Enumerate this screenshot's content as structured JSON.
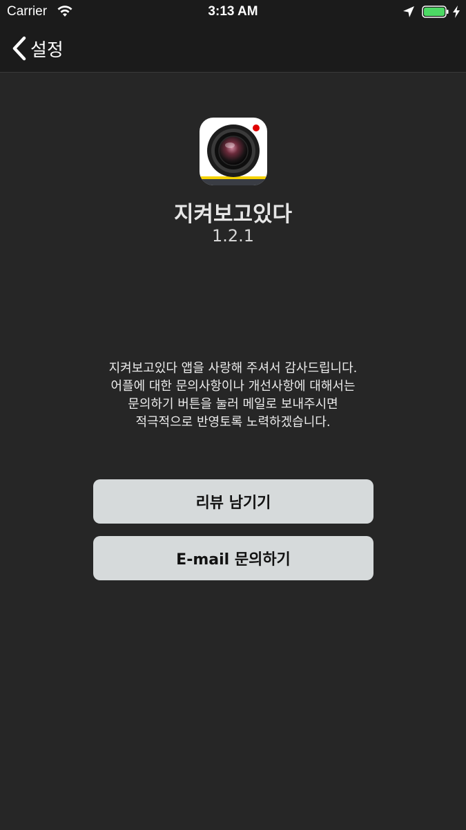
{
  "status_bar": {
    "carrier": "Carrier",
    "time": "3:13 AM",
    "battery_level": 1.0,
    "battery_color": "#4cd964"
  },
  "nav": {
    "back_label": "설정",
    "back_icon": "chevron-left-icon"
  },
  "app": {
    "icon": "camera-lens-icon",
    "name": "지켜보고있다",
    "version": "1.2.1"
  },
  "message": {
    "lines": [
      "지켜보고있다 앱을 사랑해 주셔서 감사드립니다.",
      "어플에 대한 문의사항이나 개선사항에 대해서는",
      "문의하기 버튼을 눌러 메일로 보내주시면",
      "적극적으로 반영토록 노력하겠습니다."
    ]
  },
  "buttons": {
    "review_label": "리뷰 남기기",
    "email_label": "E-mail 문의하기"
  },
  "colors": {
    "background": "#262626",
    "bar": "#1b1b1b",
    "button": "#d6dadb",
    "icon_accent_yellow": "#f5d200",
    "record_dot_red": "#e00000"
  }
}
